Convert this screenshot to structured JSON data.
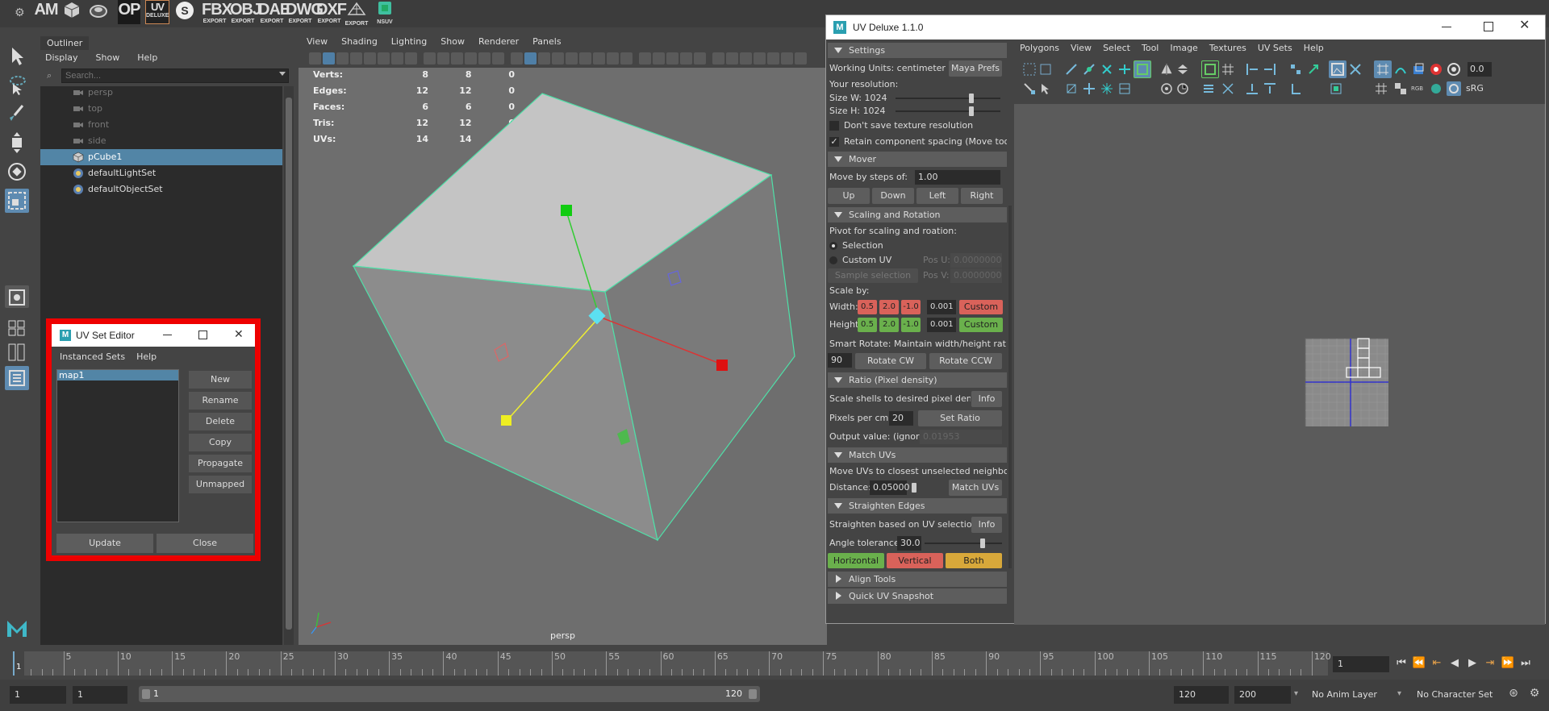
{
  "shelf": {
    "items": [
      {
        "big": "AM",
        "sm": ""
      },
      {
        "big": "OP",
        "sm": ""
      },
      {
        "big": "UV",
        "sm": "DELUXE"
      },
      {
        "big": "FBX",
        "sm": "EXPORT"
      },
      {
        "big": "OBJ",
        "sm": "EXPORT"
      },
      {
        "big": "DAE",
        "sm": "EXPORT"
      },
      {
        "big": "DWG",
        "sm": "EXPORT"
      },
      {
        "big": "DXF",
        "sm": "EXPORT"
      },
      {
        "big": "",
        "sm": "EXPORT"
      },
      {
        "big": "",
        "sm": "NSUV"
      }
    ]
  },
  "outliner": {
    "tab": "Outliner",
    "menu": [
      "Display",
      "Show",
      "Help"
    ],
    "search_placeholder": "Search...",
    "items": [
      {
        "label": "persp",
        "dim": true,
        "icon": "camera"
      },
      {
        "label": "top",
        "dim": true,
        "icon": "camera"
      },
      {
        "label": "front",
        "dim": true,
        "icon": "camera"
      },
      {
        "label": "side",
        "dim": true,
        "icon": "camera"
      },
      {
        "label": "pCube1",
        "dim": false,
        "icon": "mesh",
        "selected": true
      },
      {
        "label": "defaultLightSet",
        "dim": false,
        "icon": "set"
      },
      {
        "label": "defaultObjectSet",
        "dim": false,
        "icon": "set"
      }
    ]
  },
  "viewport": {
    "menu": [
      "View",
      "Shading",
      "Lighting",
      "Show",
      "Renderer",
      "Panels"
    ],
    "hud": [
      {
        "label": "Verts:",
        "a": "8",
        "b": "8",
        "c": "0"
      },
      {
        "label": "Edges:",
        "a": "12",
        "b": "12",
        "c": "0"
      },
      {
        "label": "Faces:",
        "a": "6",
        "b": "6",
        "c": "0"
      },
      {
        "label": "Tris:",
        "a": "12",
        "b": "12",
        "c": "0"
      },
      {
        "label": "UVs:",
        "a": "14",
        "b": "14",
        "c": "0"
      }
    ],
    "camera_label": "persp"
  },
  "timeline": {
    "ticks": [
      "5",
      "10",
      "15",
      "20",
      "25",
      "30",
      "35",
      "40",
      "45",
      "50",
      "55",
      "60",
      "65",
      "70",
      "75",
      "80",
      "85",
      "90",
      "95",
      "100",
      "105",
      "110",
      "115",
      "120"
    ],
    "current_marker": "1",
    "current_frame": "1"
  },
  "range": {
    "start": "1",
    "playback_start": "1",
    "slider_start": "1",
    "slider_end": "120",
    "playback_end": "120",
    "end": "200",
    "anim_layer": "No Anim Layer",
    "character_set": "No Character Set"
  },
  "uv_deluxe": {
    "title": "UV Deluxe 1.1.0",
    "menu": [
      "Polygons",
      "View",
      "Select",
      "Tool",
      "Image",
      "Textures",
      "UV Sets",
      "Help"
    ],
    "partial_right": [
      "0.0",
      "sRG"
    ],
    "settings": {
      "header": "Settings",
      "working_units": "Working Units: centimeter",
      "maya_prefs": "Maya Prefs",
      "your_resolution": "Your resolution:",
      "size_w": "Size W:",
      "size_w_val": "1024",
      "size_w_level": 0.72,
      "size_h": "Size H:",
      "size_h_val": "1024",
      "size_h_level": 0.72,
      "dont_save": "Don't save texture resolution",
      "dont_save_checked": false,
      "retain": "Retain component spacing (Move tool)",
      "retain_checked": true
    },
    "mover": {
      "header": "Mover",
      "move_steps": "Move by steps of:",
      "move_val": "1.00",
      "buttons": [
        "Up",
        "Down",
        "Left",
        "Right"
      ]
    },
    "scaling": {
      "header": "Scaling and Rotation",
      "pivot": "Pivot for scaling and roation:",
      "opt_selection": "Selection",
      "opt_custom": "Custom UV",
      "pos_u": "Pos U:",
      "pos_u_val": "0.0000000",
      "pos_v": "Pos V:",
      "pos_v_val": "0.0000000",
      "sample": "Sample selection",
      "scale_by": "Scale by:",
      "width": "Width:",
      "height": "Height:",
      "vals": [
        "0.5",
        "2.0",
        "-1.0"
      ],
      "fine": "0.001",
      "custom": "Custom",
      "smart_rotate": "Smart Rotate: Maintain width/height ratio",
      "angle": "90",
      "rotate_cw": "Rotate CW",
      "rotate_ccw": "Rotate CCW"
    },
    "ratio": {
      "header": "Ratio (Pixel density)",
      "scale_shells": "Scale shells to desired pixel densit",
      "info": "Info",
      "pixels_per_cm": "Pixels per cm:",
      "ppcm_val": "20",
      "set_ratio": "Set Ratio",
      "output": "Output value: (ignore",
      "output_val": "0.01953"
    },
    "match": {
      "header": "Match UVs",
      "move_text": "Move UVs to closest unselected neighbour",
      "distance": "Distance:",
      "distance_val": "0.05000",
      "match_btn": "Match UVs"
    },
    "straighten": {
      "header": "Straighten Edges",
      "based": "Straighten based on UV selection",
      "info": "Info",
      "angle_tol": "Angle tolerance",
      "angle_val": "30.0",
      "angle_level": 0.75,
      "horizontal": "Horizontal",
      "vertical": "Vertical",
      "both": "Both"
    },
    "align": {
      "header": "Align Tools"
    },
    "snapshot": {
      "header": "Quick UV Snapshot"
    }
  },
  "uv_set_editor": {
    "title": "UV Set Editor",
    "menu": [
      "Instanced Sets",
      "Help"
    ],
    "sets": [
      "map1"
    ],
    "buttons": [
      "New",
      "Rename",
      "Delete",
      "Copy",
      "Propagate",
      "Unmapped"
    ],
    "update": "Update",
    "close": "Close",
    "highlight_color": "#e00000"
  },
  "colors": {
    "selection_blue": "#5285a6",
    "wire_green": "#4fe0a8",
    "accent_red": "#d9625a",
    "accent_green": "#6ab04c",
    "accent_yellow": "#d8a83a"
  }
}
